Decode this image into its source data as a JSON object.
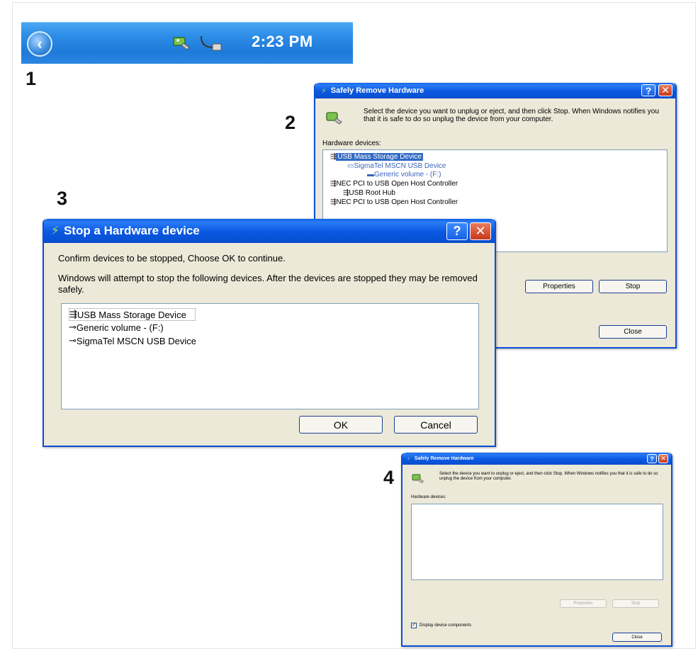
{
  "steps": [
    "1",
    "2",
    "3",
    "4"
  ],
  "taskbar": {
    "time": "2:23 PM",
    "back_icon": "chevron-left-icon",
    "tray_icons": [
      "safely-remove-hardware-icon",
      "usb-plug-icon"
    ]
  },
  "safely_remove_top": {
    "title": "Safely Remove Hardware",
    "instruction": "Select the device you want to unplug or eject, and then click Stop. When Windows notifies you that it is safe to do so unplug the device from your computer.",
    "devices_label": "Hardware devices:",
    "devices": [
      {
        "label": "USB Mass Storage Device",
        "indent": 0,
        "selected": true
      },
      {
        "label": "SigmaTel MSCN USB Device",
        "indent": 1,
        "selected": false
      },
      {
        "label": "Generic volume - (F:)",
        "indent": 2,
        "selected": false
      },
      {
        "label": "NEC PCI to USB Open Host Controller",
        "indent": 0,
        "selected": false
      },
      {
        "label": "USB Root Hub",
        "indent": 1,
        "selected": false
      },
      {
        "label": "NEC PCI to USB Open Host Controller",
        "indent": 0,
        "selected": false
      }
    ],
    "properties_label": "Properties",
    "stop_label": "Stop",
    "close_label": "Close"
  },
  "stop_device": {
    "title": "Stop a Hardware device",
    "confirm_text": "Confirm devices to be stopped, Choose OK to continue.",
    "warning_text": "Windows will attempt to stop the following devices. After the devices are stopped they may be removed safely.",
    "devices": [
      {
        "label": "USB Mass Storage Device",
        "selected": true
      },
      {
        "label": "Generic volume - (F:)",
        "selected": false
      },
      {
        "label": "SigmaTel MSCN USB Device",
        "selected": false
      }
    ],
    "ok_label": "OK",
    "cancel_label": "Cancel"
  },
  "safely_remove_bottom": {
    "title": "Safely Remove Hardware",
    "instruction": "Select the device you want to unplug or eject, and then click Stop. When Windows notifies you that it is safe to do so unplug the device from your computer.",
    "devices_label": "Hardware devices:",
    "properties_label": "Properties",
    "stop_label": "Stop",
    "display_components_label": "Display device components",
    "close_label": "Close"
  },
  "colors": {
    "title_blue": "#0b58e1",
    "window_face": "#ece9d8",
    "selection": "#316ac5",
    "taskbar_blue": "#2f8ee8"
  }
}
